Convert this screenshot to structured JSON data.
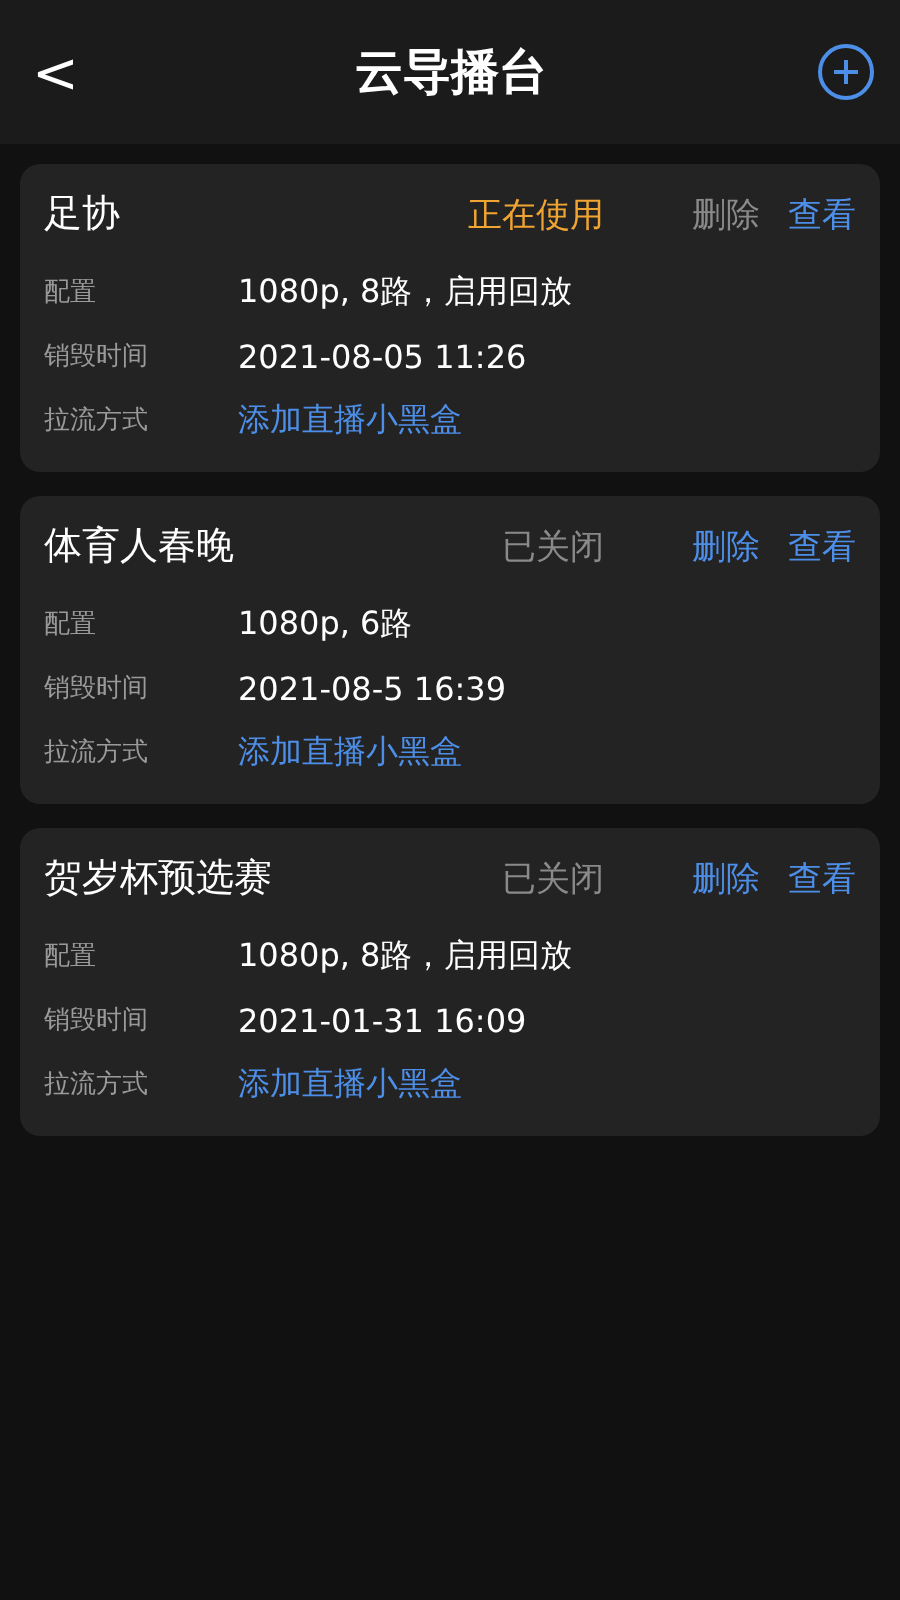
{
  "header": {
    "back": "<",
    "title": "云导播台"
  },
  "cards": [
    {
      "name": "足协",
      "status": {
        "kind": "active",
        "text": "正在使用"
      },
      "delete": {
        "label": "删除",
        "disabled": true
      },
      "view": "查看",
      "rows": [
        {
          "label": "配置",
          "value": "1080p, 8路，启用回放",
          "kind": "text"
        },
        {
          "label": "销毁时间",
          "value": "2021-08-05 11:26",
          "kind": "text"
        },
        {
          "label": "拉流方式",
          "value": "添加直播小黑盒",
          "kind": "link"
        }
      ]
    },
    {
      "name": "体育人春晚",
      "status": {
        "kind": "closed",
        "text": "已关闭"
      },
      "delete": {
        "label": "删除",
        "disabled": false
      },
      "view": "查看",
      "rows": [
        {
          "label": "配置",
          "value": "1080p, 6路",
          "kind": "text"
        },
        {
          "label": "销毁时间",
          "value": "2021-08-5 16:39",
          "kind": "text"
        },
        {
          "label": "拉流方式",
          "value": "添加直播小黑盒",
          "kind": "link"
        }
      ]
    },
    {
      "name": "贺岁杯预选赛",
      "status": {
        "kind": "closed",
        "text": "已关闭"
      },
      "delete": {
        "label": "删除",
        "disabled": false
      },
      "view": "查看",
      "rows": [
        {
          "label": "配置",
          "value": "1080p, 8路，启用回放",
          "kind": "text"
        },
        {
          "label": "销毁时间",
          "value": "2021-01-31 16:09",
          "kind": "text"
        },
        {
          "label": "拉流方式",
          "value": "添加直播小黑盒",
          "kind": "link"
        }
      ]
    }
  ]
}
